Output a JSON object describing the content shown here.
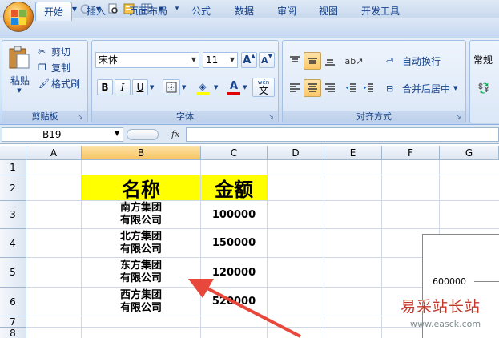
{
  "tabs": [
    "开始",
    "插入",
    "页面布局",
    "公式",
    "数据",
    "审阅",
    "视图",
    "开发工具"
  ],
  "clipboard": {
    "paste": "粘贴",
    "cut": "剪切",
    "copy": "复制",
    "format_painter": "格式刷",
    "label": "剪贴板"
  },
  "font": {
    "name": "宋体",
    "size": "11",
    "grow": "A",
    "shrink": "A",
    "bold": "B",
    "italic": "I",
    "underline": "U",
    "color_letter": "A",
    "phonetic": "wén",
    "phonetic_char": "文",
    "label": "字体"
  },
  "alignment": {
    "wrap": "自动换行",
    "merge": "合并后居中",
    "label": "对齐方式"
  },
  "number": {
    "format": "常规"
  },
  "namebox": "B19",
  "fx": "fx",
  "columns": [
    "A",
    "B",
    "C",
    "D",
    "E",
    "F",
    "G"
  ],
  "rows": [
    "1",
    "2",
    "3",
    "4",
    "5",
    "6",
    "7",
    "8"
  ],
  "sheet": {
    "header_name": "名称",
    "header_amount": "金额",
    "data": [
      {
        "name_line1": "南方集团",
        "name_line2": "有限公司",
        "amount": "100000"
      },
      {
        "name_line1": "北方集团",
        "name_line2": "有限公司",
        "amount": "150000"
      },
      {
        "name_line1": "东方集团",
        "name_line2": "有限公司",
        "amount": "120000"
      },
      {
        "name_line1": "西方集团",
        "name_line2": "有限公司",
        "amount": "520000"
      }
    ]
  },
  "chart_axis_label": "600000",
  "watermark": {
    "title": "易采站长站",
    "url": "www.easck.com"
  },
  "colors": {
    "header_fill": "#ffff00",
    "arrow": "#e8483b",
    "watermark": "#c0392b"
  }
}
